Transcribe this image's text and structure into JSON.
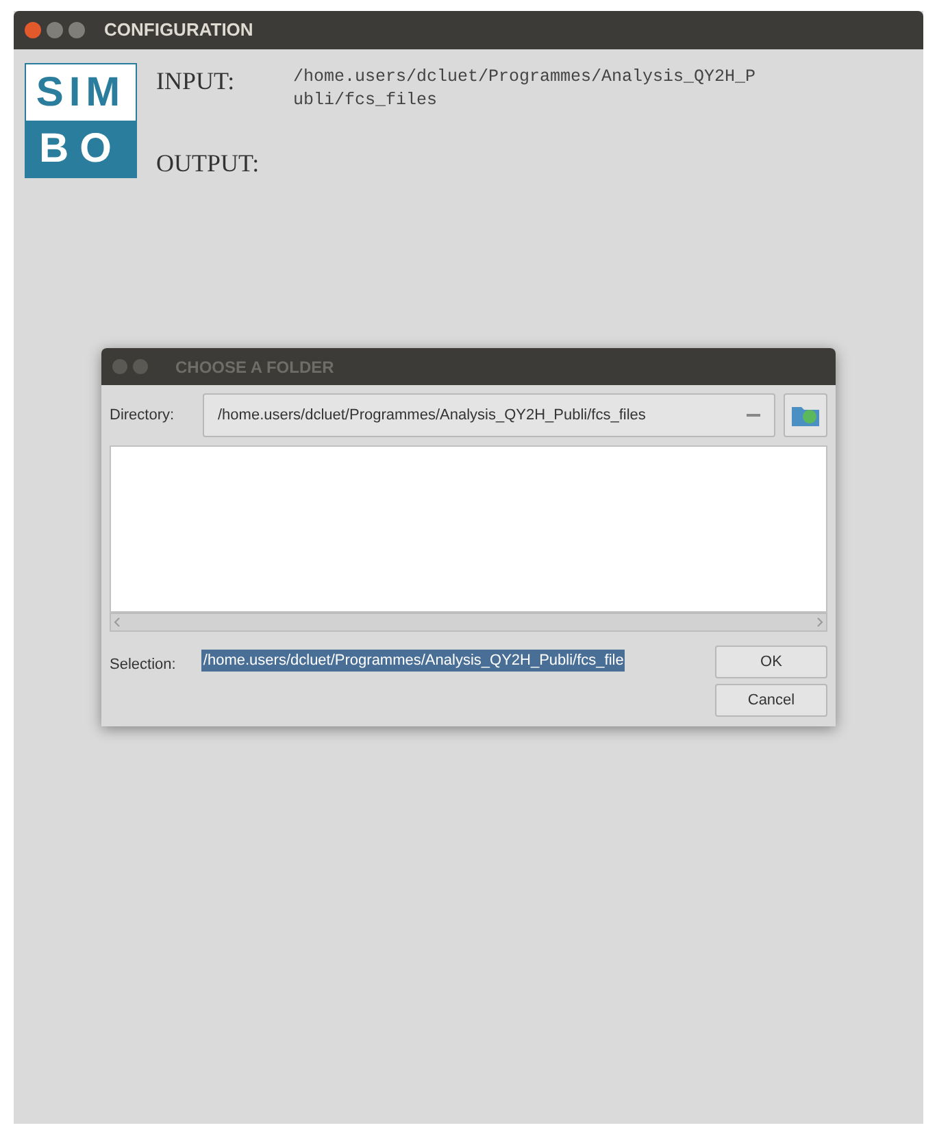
{
  "window": {
    "title": "CONFIGURATION"
  },
  "logo": {
    "top": "SIM",
    "bottom": "BO"
  },
  "fields": [
    {
      "label": "INPUT:",
      "value_lines": [
        "/home.users/dcluet/Programmes/Analysis_QY2H_P",
        "ubli/fcs_files"
      ]
    },
    {
      "label": "OUTPUT:"
    }
  ],
  "dialog": {
    "title": "CHOOSE A FOLDER",
    "directory": {
      "label": "Directory:",
      "value": "/home.users/dcluet/Programmes/Analysis_QY2H_Publi/fcs_files"
    },
    "selection": {
      "label": "Selection:",
      "value": "/home.users/dcluet/Programmes/Analysis_QY2H_Publi/fcs_file",
      "text_selected": true
    },
    "buttons": [
      "OK",
      "Cancel"
    ]
  }
}
